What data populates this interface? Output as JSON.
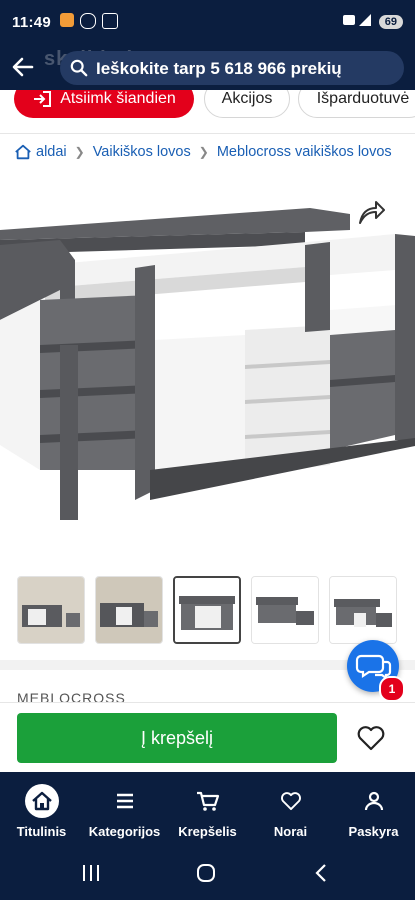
{
  "status": {
    "time": "11:49",
    "battery": "69"
  },
  "header": {
    "watermark": "skelbiu.lt",
    "search_placeholder": "Ieškokite tarp 5 618 966 prekių"
  },
  "chips": [
    {
      "label": "Atsiimk šiandien"
    },
    {
      "label": "Akcijos"
    },
    {
      "label": "Išparduotuvė"
    }
  ],
  "breadcrumb": [
    {
      "label": "aldai"
    },
    {
      "label": "Vaikiškos lovos"
    },
    {
      "label": "Meblocross vaikiškos lovos"
    }
  ],
  "product": {
    "brand": "MEBLOCROSS",
    "thumbnail_count": 5,
    "active_thumbnail": 3
  },
  "chat": {
    "badge": "1"
  },
  "cart": {
    "add_label": "Į krepšelį"
  },
  "nav": [
    {
      "label": "Titulinis",
      "icon": "home-icon"
    },
    {
      "label": "Kategorijos",
      "icon": "menu-icon"
    },
    {
      "label": "Krepšelis",
      "icon": "cart-icon"
    },
    {
      "label": "Norai",
      "icon": "heart-icon"
    },
    {
      "label": "Paskyra",
      "icon": "user-icon"
    }
  ],
  "colors": {
    "navy": "#0b1e3f",
    "red": "#e3001b",
    "green": "#1ba03a",
    "link": "#1a5fb4"
  }
}
